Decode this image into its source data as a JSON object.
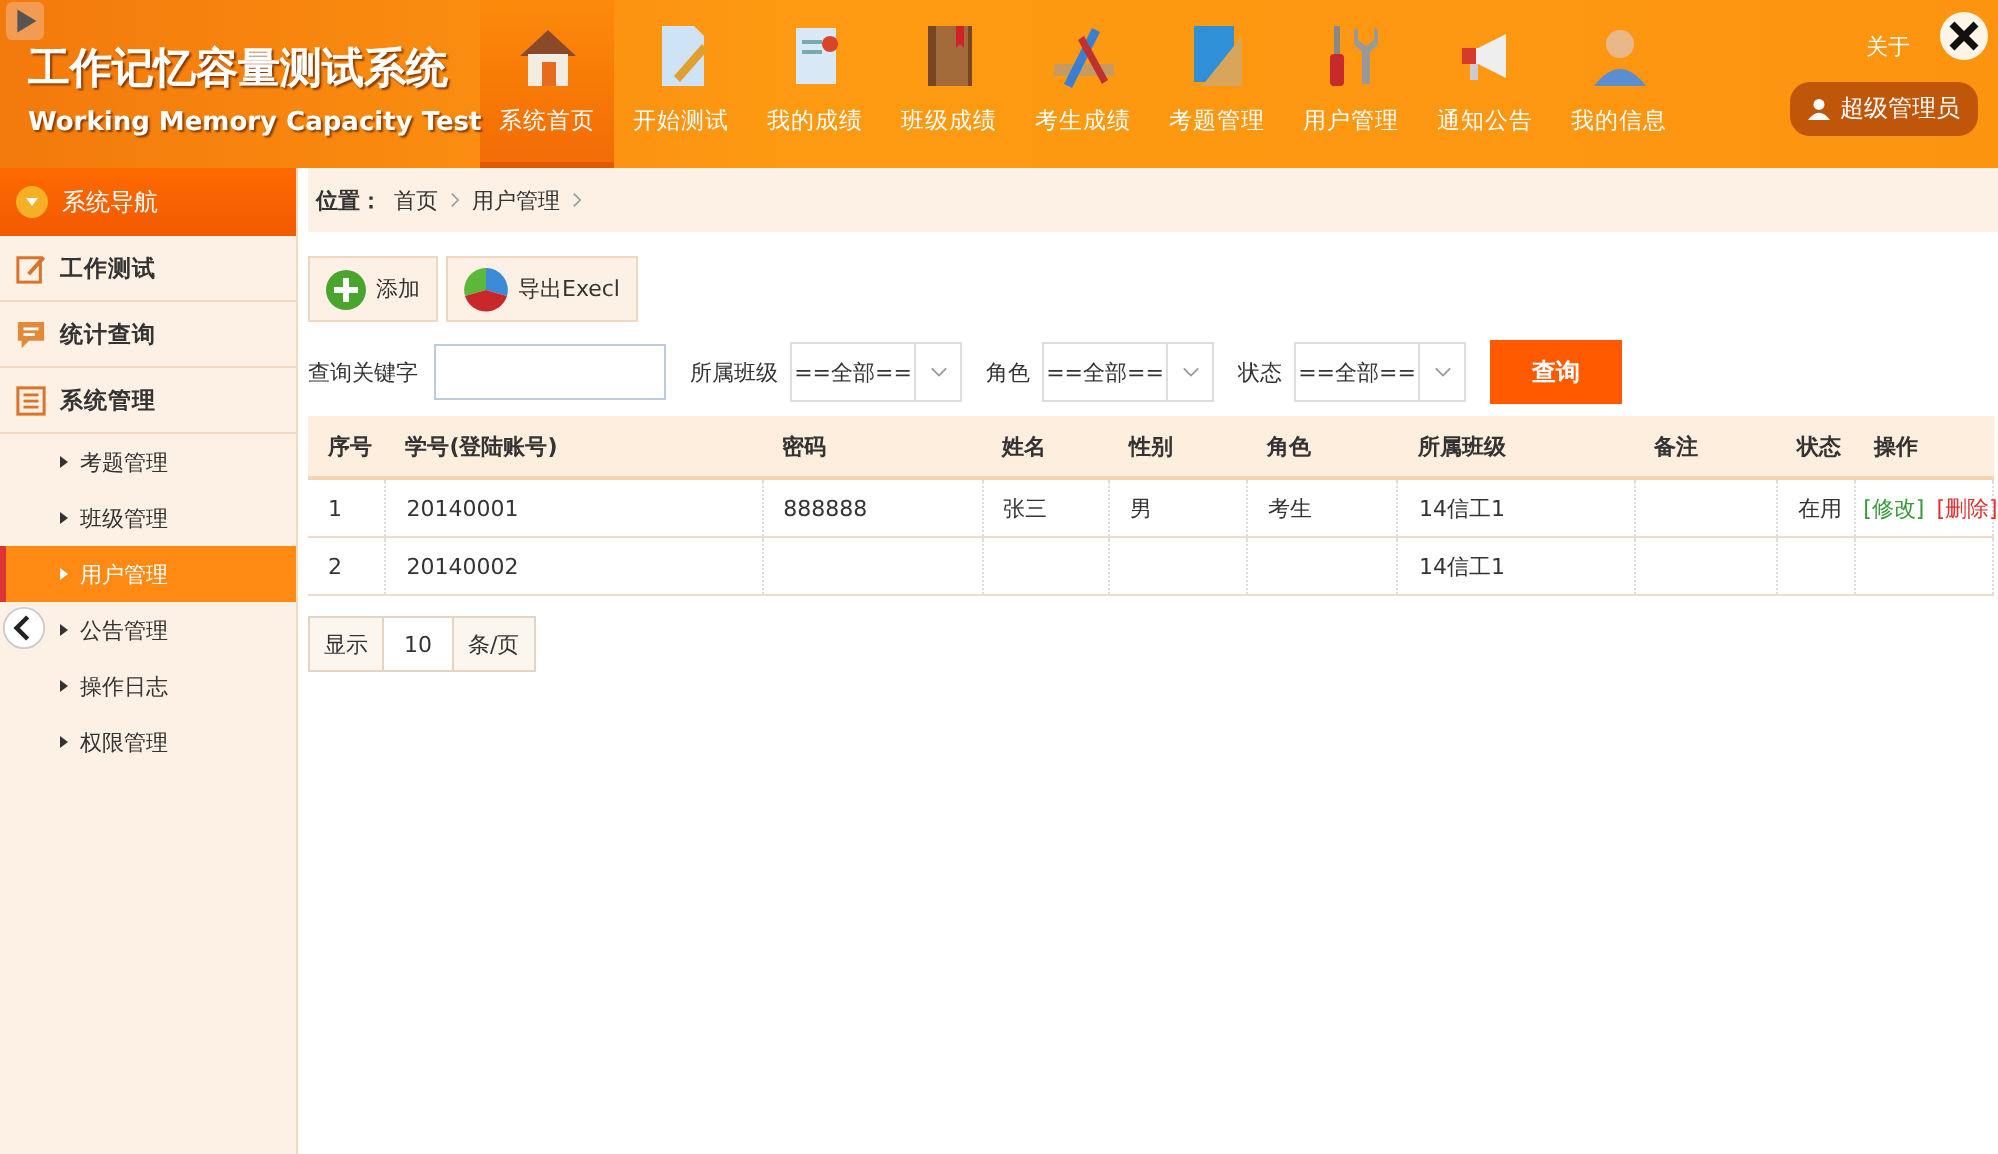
{
  "header": {
    "title": "工作记忆容量测试系统",
    "subtitle": "Working Memory Capacity Test",
    "nav": [
      {
        "label": "系统首页",
        "selected": true
      },
      {
        "label": "开始测试",
        "selected": false
      },
      {
        "label": "我的成绩",
        "selected": false
      },
      {
        "label": "班级成绩",
        "selected": false
      },
      {
        "label": "考生成绩",
        "selected": false
      },
      {
        "label": "考题管理",
        "selected": false
      },
      {
        "label": "用户管理",
        "selected": false
      },
      {
        "label": "通知公告",
        "selected": false
      },
      {
        "label": "我的信息",
        "selected": false
      }
    ],
    "top_links": [
      "关于"
    ],
    "user": "超级管理员"
  },
  "sidebar": {
    "title": "系统导航",
    "sections": [
      {
        "label": "工作测试"
      },
      {
        "label": "统计查询"
      },
      {
        "label": "系统管理",
        "children": [
          {
            "label": "考题管理",
            "selected": false
          },
          {
            "label": "班级管理",
            "selected": false
          },
          {
            "label": "用户管理",
            "selected": true
          },
          {
            "label": "公告管理",
            "selected": false
          },
          {
            "label": "操作日志",
            "selected": false
          },
          {
            "label": "权限管理",
            "selected": false
          }
        ]
      }
    ]
  },
  "breadcrumb": {
    "label": "位置：",
    "items": [
      "首页",
      "用户管理"
    ]
  },
  "toolbar": [
    {
      "label": "添加",
      "kind": "add"
    },
    {
      "label": "导出Execl",
      "kind": "export"
    }
  ],
  "filters": {
    "keyword_label": "查询关键字",
    "selects": [
      {
        "label": "所属班级",
        "value": "==全部=="
      },
      {
        "label": "角色",
        "value": "==全部=="
      },
      {
        "label": "状态",
        "value": "==全部=="
      }
    ],
    "search_button": "查询"
  },
  "table": {
    "columns": [
      "序号",
      "学号(登陆账号)",
      "密码",
      "姓名",
      "性别",
      "角色",
      "所属班级",
      "备注",
      "状态",
      "操作"
    ],
    "rows": [
      {
        "cells": [
          "1",
          "20140001",
          "888888",
          "张三",
          "男",
          "考生",
          "14信工1",
          "",
          "在用"
        ],
        "actions": [
          {
            "label": "[修改]",
            "kind": "edit"
          },
          {
            "label": "[删除]",
            "kind": "delete"
          }
        ]
      },
      {
        "cells": [
          "2",
          "20140002",
          "",
          "",
          "",
          "",
          "14信工1",
          "",
          ""
        ],
        "actions": []
      }
    ]
  },
  "pagination": {
    "show_label": "显示",
    "page_size": "10",
    "unit": "条/页"
  }
}
